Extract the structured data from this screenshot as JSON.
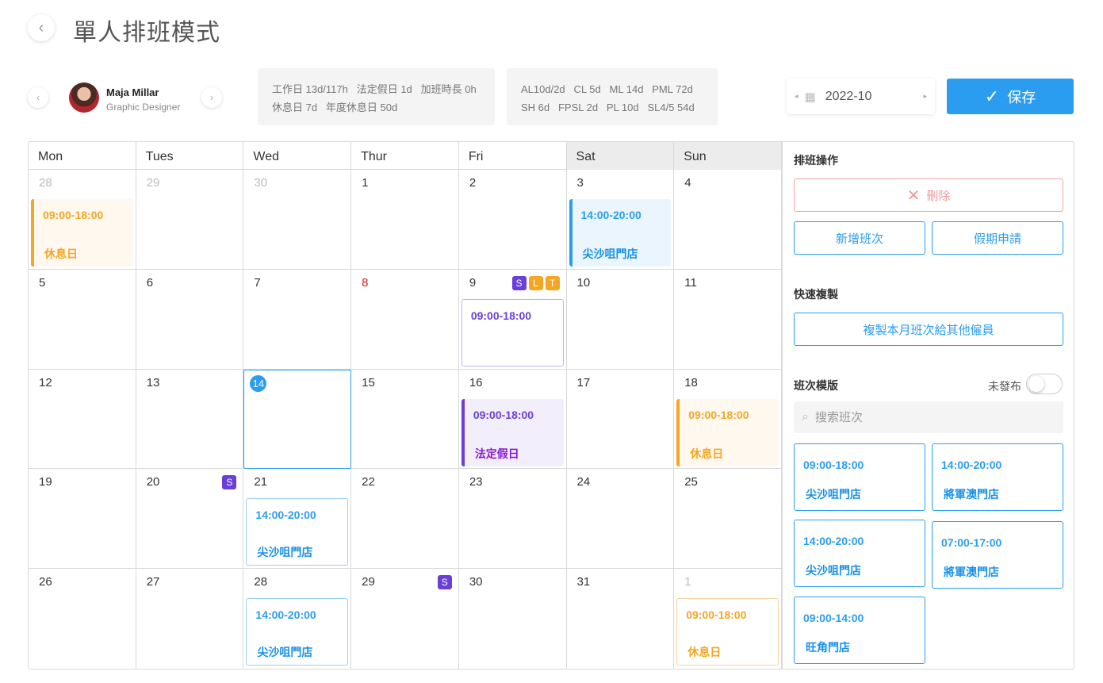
{
  "page_title": "單人排班模式",
  "employee": {
    "name": "Maja Millar",
    "role": "Graphic Designer"
  },
  "stats1": {
    "line1": "工作日 13d/117h   法定假日 1d   加班時長 0h",
    "line2": "休息日 7d   年度休息日 50d"
  },
  "stats2": {
    "line1": "AL10d/2d   CL 5d   ML 14d   PML 72d",
    "line2": "SH 6d   FPSL 2d   PL 10d   SL4/5 54d"
  },
  "month": "2022-10",
  "save_label": "保存",
  "weekdays": [
    "Mon",
    "Tues",
    "Wed",
    "Thur",
    "Fri",
    "Sat",
    "Sun"
  ],
  "days": [
    {
      "num": "28",
      "muted": true,
      "shift": {
        "time": "09:00-18:00",
        "loc": "休息日",
        "style": "s-orange"
      }
    },
    {
      "num": "29",
      "muted": true
    },
    {
      "num": "30",
      "muted": true
    },
    {
      "num": "1"
    },
    {
      "num": "2"
    },
    {
      "num": "3",
      "shift": {
        "time": "14:00-20:00",
        "loc": "尖沙咀門店",
        "style": "s-blue"
      }
    },
    {
      "num": "4"
    },
    {
      "num": "5"
    },
    {
      "num": "6"
    },
    {
      "num": "7"
    },
    {
      "num": "8",
      "red": true
    },
    {
      "num": "9",
      "badges": [
        "S",
        "L",
        "T"
      ],
      "shift": {
        "time": "09:00-18:00",
        "loc": "",
        "style": "s-purple-o"
      }
    },
    {
      "num": "10"
    },
    {
      "num": "11"
    },
    {
      "num": "12"
    },
    {
      "num": "13"
    },
    {
      "num": "14",
      "today": true
    },
    {
      "num": "15"
    },
    {
      "num": "16",
      "shift": {
        "time": "09:00-18:00",
        "loc": "法定假日",
        "style": "s-purple"
      }
    },
    {
      "num": "17"
    },
    {
      "num": "18",
      "shift": {
        "time": "09:00-18:00",
        "loc": "休息日",
        "style": "s-orange"
      }
    },
    {
      "num": "19"
    },
    {
      "num": "20",
      "badges": [
        "S"
      ]
    },
    {
      "num": "21",
      "shift": {
        "time": "14:00-20:00",
        "loc": "尖沙咀門店",
        "style": "s-blue-o"
      }
    },
    {
      "num": "22"
    },
    {
      "num": "23"
    },
    {
      "num": "24"
    },
    {
      "num": "25"
    },
    {
      "num": "26"
    },
    {
      "num": "27"
    },
    {
      "num": "28",
      "shift": {
        "time": "14:00-20:00",
        "loc": "尖沙咀門店",
        "style": "s-blue-o"
      }
    },
    {
      "num": "29",
      "badges": [
        "S"
      ]
    },
    {
      "num": "30"
    },
    {
      "num": "31"
    },
    {
      "num": "1",
      "muted": true,
      "shift": {
        "time": "09:00-18:00",
        "loc": "休息日",
        "style": "s-orange-o"
      }
    }
  ],
  "panel": {
    "ops_title": "排班操作",
    "delete_label": "刪除",
    "add_shift_label": "新增班次",
    "leave_label": "假期申請",
    "copy_title": "快速複製",
    "copy_label": "複製本月班次給其他僱員",
    "tpl_title": "班次模版",
    "toggle_label": "未發布",
    "search_placeholder": "搜索班次",
    "templates": [
      {
        "time": "09:00-18:00",
        "loc": "尖沙咀門店"
      },
      {
        "time": "14:00-20:00",
        "loc": "將軍澳門店"
      },
      {
        "time": "14:00-20:00",
        "loc": "尖沙咀門店"
      },
      {
        "time": "07:00-17:00",
        "loc": "將軍澳門店"
      },
      {
        "time": "09:00-14:00",
        "loc": "旺角門店"
      }
    ]
  },
  "colors": {
    "accent": "#2b9df0",
    "purple": "#6a3fd6",
    "orange": "#f5a623",
    "danger": "#f59a9a"
  }
}
